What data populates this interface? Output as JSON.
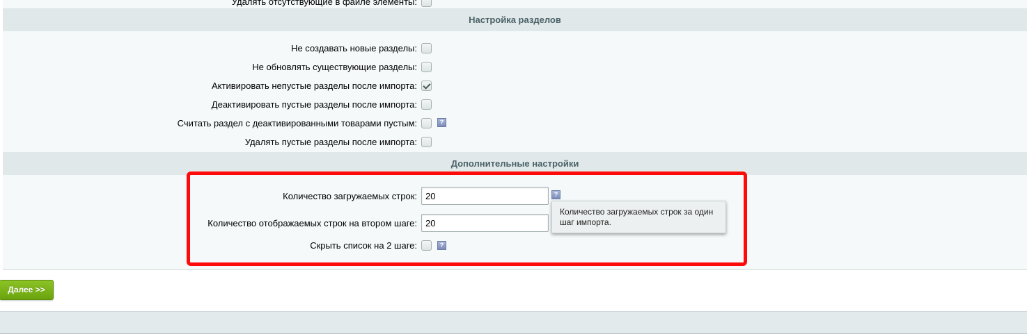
{
  "partial_row": {
    "label": "Удалять отсутствующие в файле элементы:",
    "checked": false
  },
  "sections_settings": {
    "header": "Настройка разделов",
    "rows": [
      {
        "label": "Не создавать новые разделы:",
        "checked": false
      },
      {
        "label": "Не обновлять существующие разделы:",
        "checked": false
      },
      {
        "label": "Активировать непустые разделы после импорта:",
        "checked": true
      },
      {
        "label": "Деактивировать пустые разделы после импорта:",
        "checked": false
      },
      {
        "label": "Считать раздел с деактивированными товарами пустым:",
        "checked": false,
        "help": "?"
      },
      {
        "label": "Удалять пустые разделы после импорта:",
        "checked": false
      }
    ]
  },
  "additional_settings": {
    "header": "Дополнительные настройки",
    "rows_to_load": {
      "label": "Количество загружаемых строк:",
      "value": "20",
      "help": "?",
      "tooltip": "Количество загружаемых строк за один шаг импорта."
    },
    "rows_to_display": {
      "label": "Количество отображаемых строк на втором шаге:",
      "value": "20"
    },
    "hide_list": {
      "label": "Скрыть список на 2 шаге:",
      "checked": false,
      "help": "?"
    }
  },
  "buttons": {
    "next_label": "Далее >>"
  },
  "colors": {
    "highlight": "#ff0a0a",
    "section_header_bg": "#e0e8ea",
    "panel_bg": "#f5f9f9",
    "next_button": "#7ab319"
  },
  "icons": {
    "help": "help-question-icon",
    "checkmark": "checkmark-icon"
  }
}
